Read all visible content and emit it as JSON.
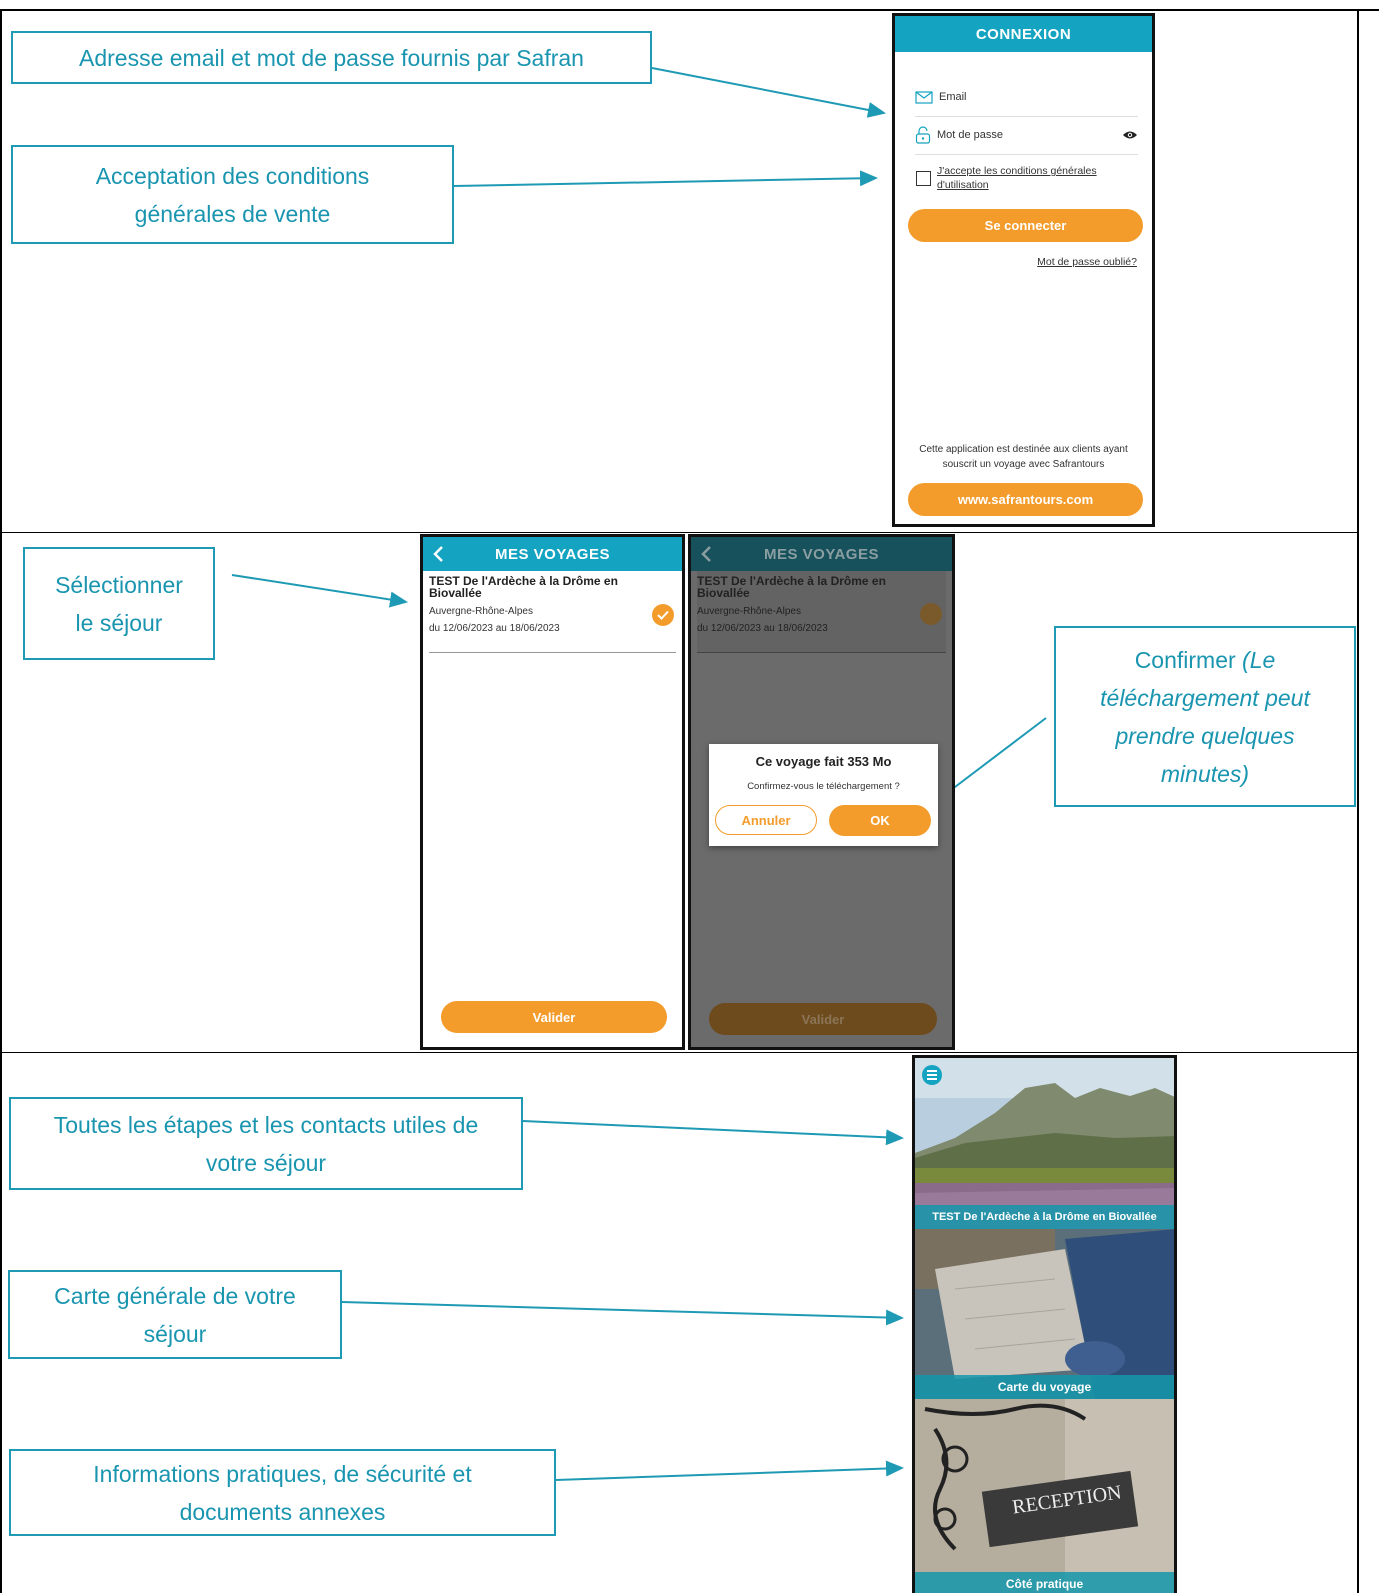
{
  "callouts": {
    "login_credentials": "Adresse email et mot de passe fournis par Safran",
    "accept_terms": "Acceptation des conditions générales de vente",
    "select_trip": "Sélectionner le séjour",
    "confirm_main": "Confirmer ",
    "confirm_note": "(Le téléchargement peut prendre quelques minutes)",
    "all_steps": "Toutes les étapes et les contacts utiles de votre séjour",
    "general_map": "Carte générale de votre séjour",
    "practical_info": "Informations pratiques, de sécurité et documents annexes"
  },
  "login_screen": {
    "header": "CONNEXION",
    "email_placeholder": "Email",
    "password_placeholder": "Mot de passe",
    "terms_line1": "J'accepte les conditions générales",
    "terms_line2": "d'utilisation",
    "connect_button": "Se connecter",
    "forgot_password": "Mot de passe oublié?",
    "footer_line1": "Cette application est destinée aux clients ayant",
    "footer_line2": "souscrit un voyage avec Safrantours",
    "website_button": "www.safrantours.com"
  },
  "trips_screen": {
    "header": "MES VOYAGES",
    "trip_title_line1": "TEST De l'Ardèche à la Drôme en",
    "trip_title_line2": "Biovallée",
    "trip_region": "Auvergne-Rhône-Alpes",
    "trip_dates": "du 12/06/2023 au 18/06/2023",
    "validate_button": "Valider"
  },
  "confirm_dialog": {
    "title": "Ce voyage fait 353 Mo",
    "message": "Confirmez-vous le téléchargement ?",
    "cancel_button": "Annuler",
    "ok_button": "OK"
  },
  "home_screen": {
    "tile1_label": "TEST De l'Ardèche à la Drôme en Biovallée",
    "tile2_label": "Carte du voyage",
    "tile3_label": "Côté pratique",
    "sign_text": "RECEPTION"
  },
  "colors": {
    "teal": "#14a3c0",
    "orange": "#f39c2b",
    "callout_text": "#1a95b0"
  }
}
